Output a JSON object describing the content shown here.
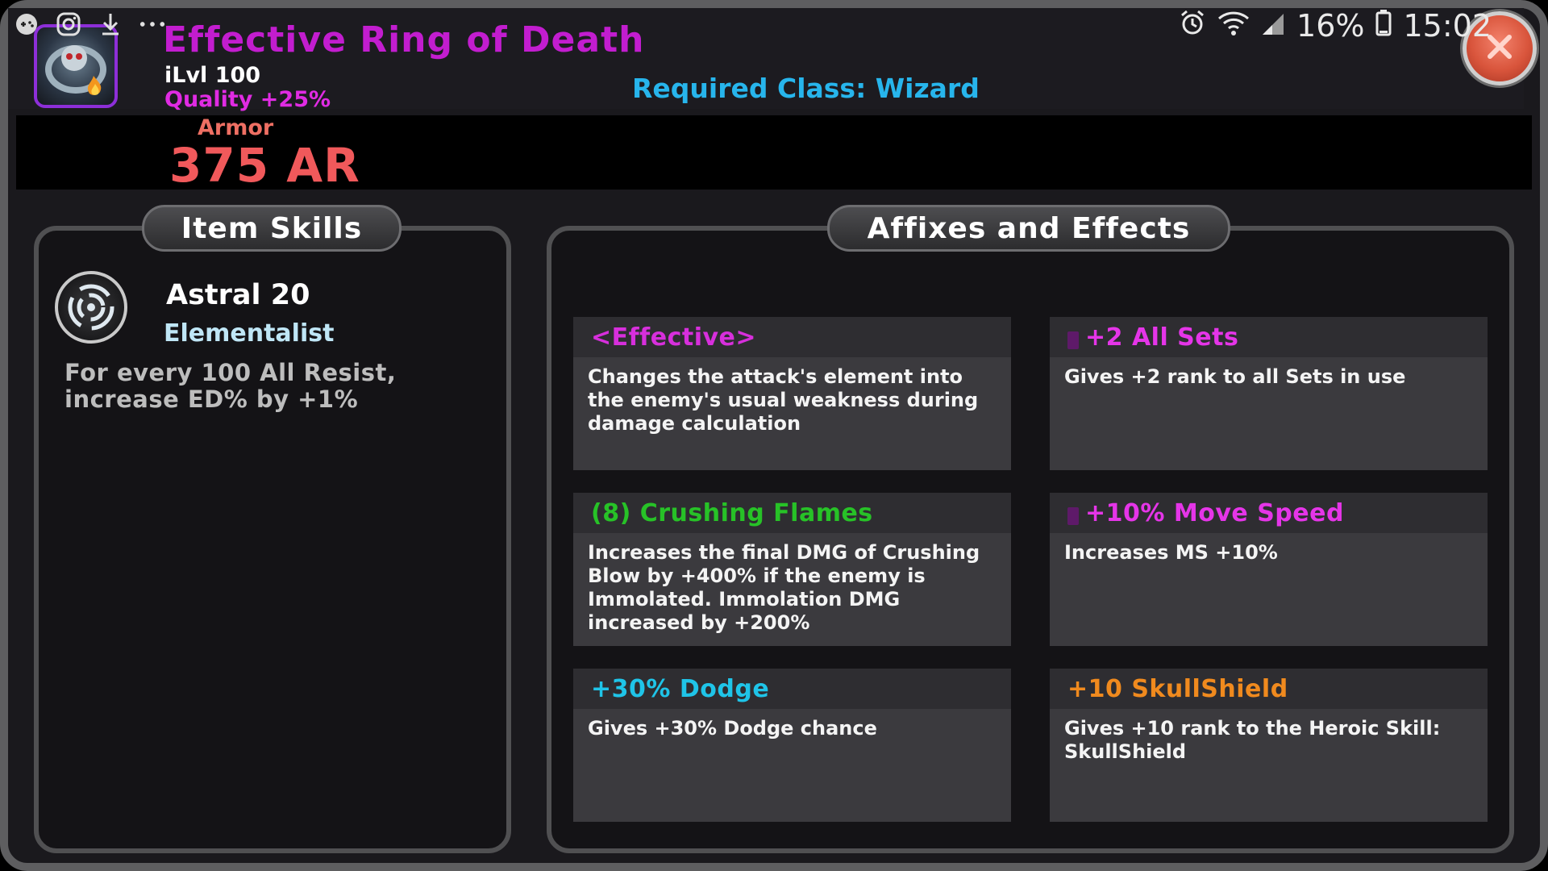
{
  "status_bar": {
    "left_icons": [
      "game-controller-icon",
      "instagram-icon",
      "download-icon",
      "more-dots-icon"
    ],
    "battery_percent": "16%",
    "time": "15:02"
  },
  "item": {
    "title": "Effective Ring of Death",
    "ilvl": "iLvl 100",
    "quality": "Quality +25%",
    "required_class": "Required Class: Wizard"
  },
  "armor": {
    "label": "Armor",
    "value": "375 AR"
  },
  "item_skills": {
    "tab_label": "Item Skills",
    "skill": {
      "name": "Astral 20",
      "class": "Elementalist",
      "description": "For every 100 All Resist, increase ED% by +1%"
    }
  },
  "affixes": {
    "tab_label": "Affixes and Effects",
    "cards": [
      {
        "title": "<Effective>",
        "color": "#d72fdc",
        "gem": false,
        "description": "Changes the attack's element into the enemy's usual weakness during damage calculation"
      },
      {
        "title": "+2 All Sets",
        "color": "#e535e8",
        "gem": true,
        "description": "Gives +2 rank to all Sets in use"
      },
      {
        "title": "(8) Crushing Flames",
        "color": "#27c227",
        "gem": false,
        "description": "Increases the final DMG of Crushing Blow by +400% if the enemy is Immolated. Immolation DMG increased by +200%"
      },
      {
        "title": "+10% Move Speed",
        "color": "#e535e8",
        "gem": true,
        "description": "Increases MS +10%"
      },
      {
        "title": "+30% Dodge",
        "color": "#1fc4e8",
        "gem": false,
        "description": "Gives +30% Dodge chance"
      },
      {
        "title": "+10 SkullShield",
        "color": "#f08a1e",
        "gem": false,
        "description": "Gives +10 rank to the Heroic Skill: SkullShield"
      }
    ]
  },
  "colors": {
    "title": "#c21dcf",
    "quality": "#e02be3",
    "required_class": "#27b5ec",
    "armor": "#f0595b"
  }
}
